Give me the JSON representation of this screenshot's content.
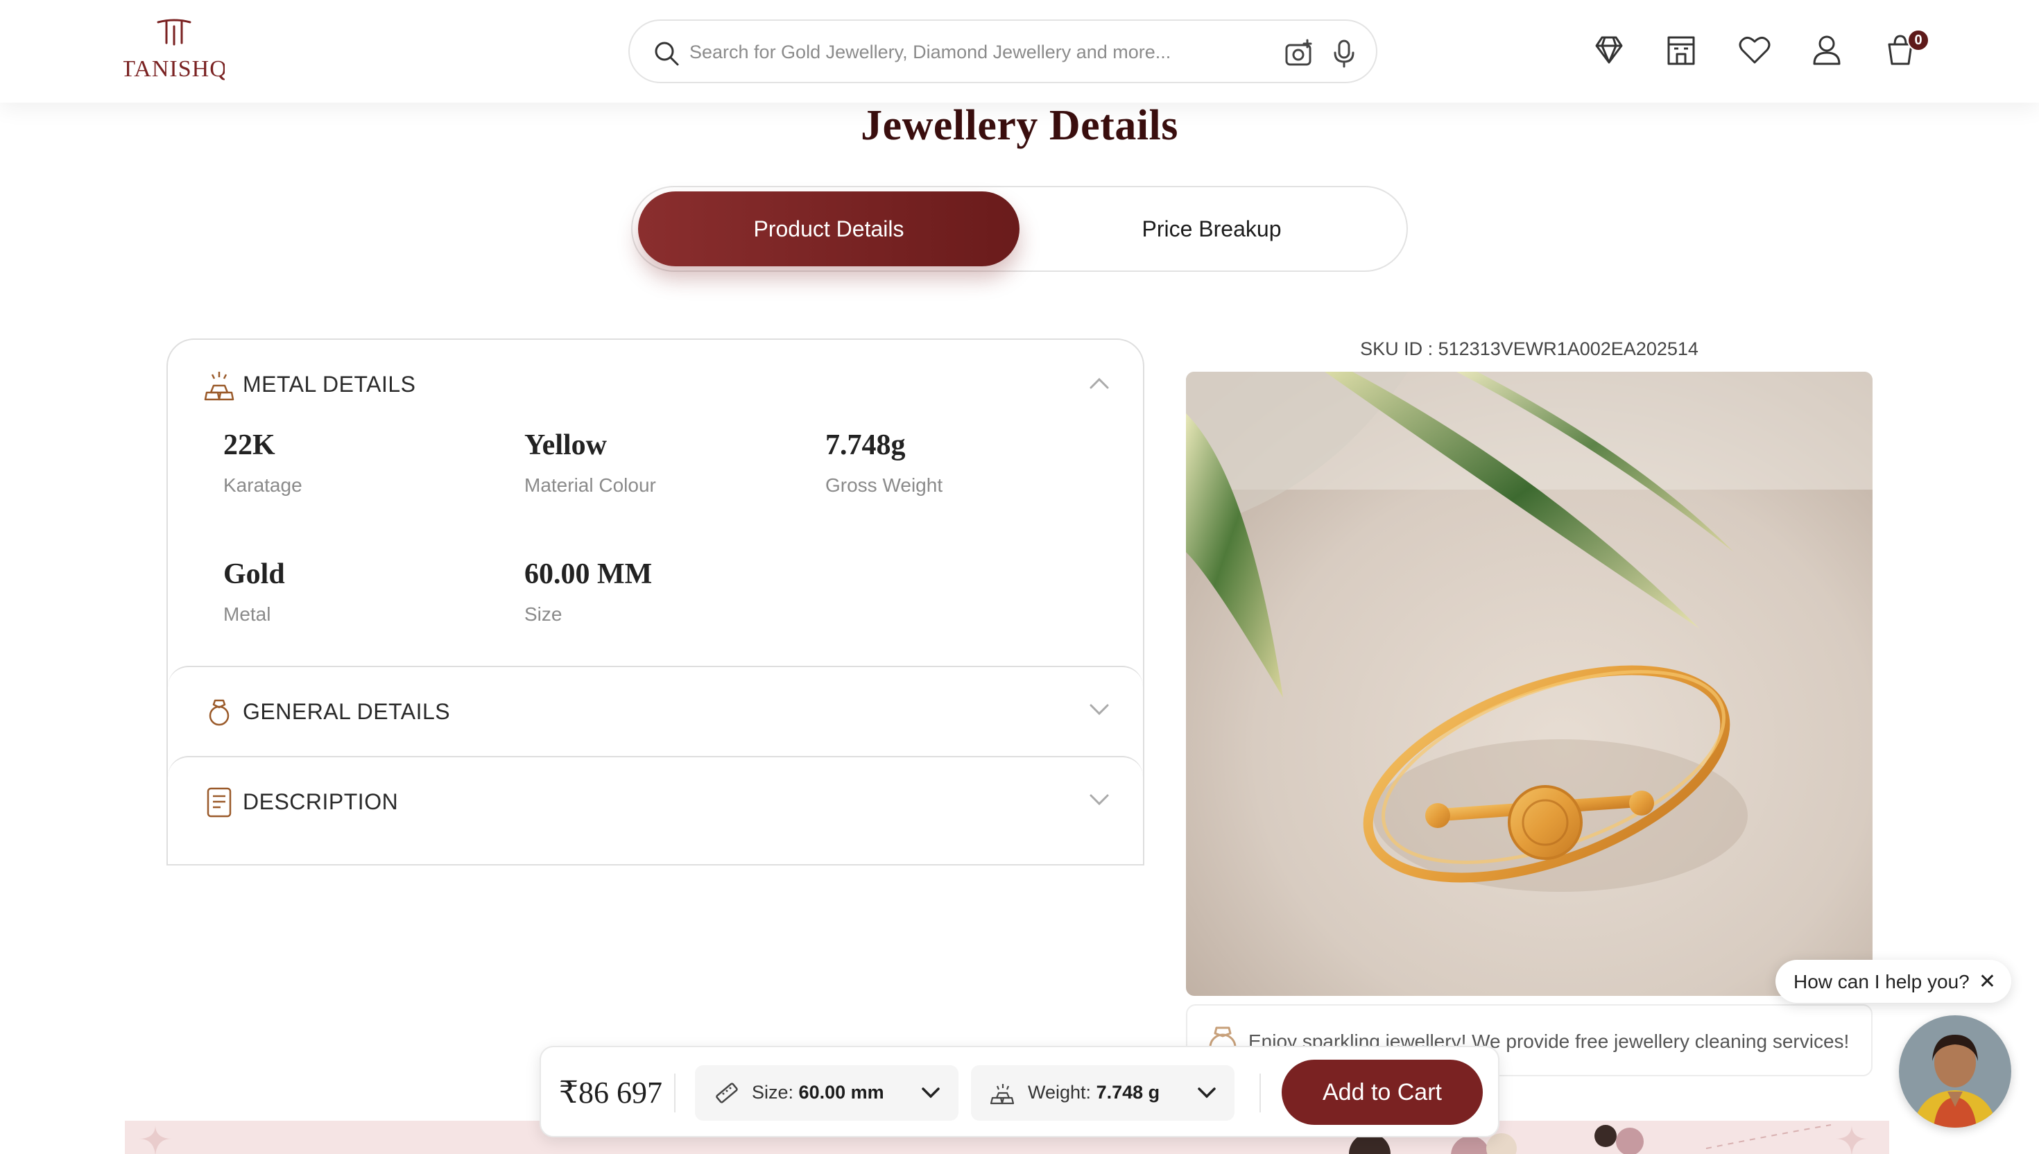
{
  "header": {
    "logo_text": "TANISHQ",
    "search": {
      "placeholder": "Search for Gold Jewellery, Diamond Jewellery and more..."
    },
    "icons": [
      "diamond-icon",
      "store-icon",
      "heart-icon",
      "user-icon",
      "cart-icon"
    ],
    "cart_count": "0"
  },
  "page": {
    "title": "Jewellery Details",
    "tabs": [
      {
        "label": "Product Details",
        "active": true
      },
      {
        "label": "Price Breakup",
        "active": false
      }
    ]
  },
  "details": {
    "metal": {
      "heading": "METAL DETAILS",
      "expanded": true,
      "attributes": [
        {
          "value": "22K",
          "label": "Karatage"
        },
        {
          "value": "Yellow",
          "label": "Material Colour"
        },
        {
          "value": "7.748g",
          "label": "Gross Weight"
        },
        {
          "value": "Gold",
          "label": "Metal"
        },
        {
          "value": "60.00 MM",
          "label": "Size"
        }
      ]
    },
    "general": {
      "heading": "GENERAL DETAILS",
      "expanded": false
    },
    "description": {
      "heading": "DESCRIPTION",
      "expanded": false
    }
  },
  "product": {
    "sku_label": "SKU ID :",
    "sku_value": "512313VEWR1A002EA202514",
    "image_alt": "gold bangle with round motif on beige fabric",
    "promo_text": "Enjoy sparkling jewellery! We provide free jewellery cleaning services!"
  },
  "help": {
    "text": "How can I help you?",
    "close": "✕"
  },
  "sticky_bar": {
    "price": "₹86 697",
    "size_label": "Size:",
    "size_value": "60.00 mm",
    "weight_label": "Weight:",
    "weight_value": "7.748 g",
    "add_to_cart": "Add to Cart"
  },
  "colors": {
    "brand": "#7a2222",
    "title": "#3a0e0e",
    "icon_accent": "#9a5a2a"
  }
}
